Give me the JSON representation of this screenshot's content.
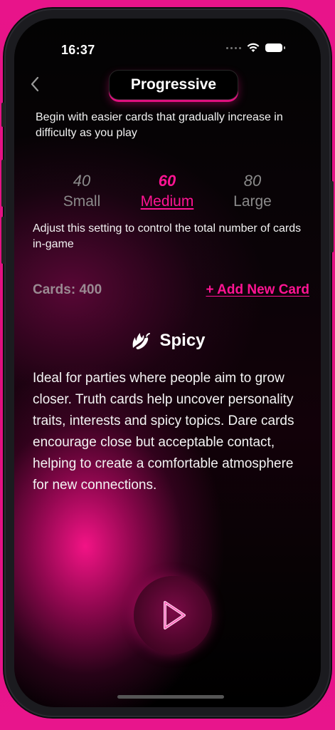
{
  "status_bar": {
    "time": "16:37"
  },
  "header": {
    "title": "Progressive"
  },
  "mode_description": "Begin with easier cards that gradually increase in difficulty as you play",
  "size_options": [
    {
      "count": "40",
      "label": "Small",
      "selected": false
    },
    {
      "count": "60",
      "label": "Medium",
      "selected": true
    },
    {
      "count": "80",
      "label": "Large",
      "selected": false
    }
  ],
  "size_description": "Adjust this setting to control the total number of cards in-game",
  "cards_count": "Cards: 400",
  "add_card_label": "+ Add New Card",
  "category": {
    "name": "Spicy",
    "icon": "chili-pepper-flame-icon",
    "description": "Ideal for parties where people aim to grow closer. Truth cards help uncover personality traits, interests and spicy topics. Dare cards encourage close but acceptable contact, helping to create a comfortable atmosphere for new connections."
  },
  "colors": {
    "accent": "#ff1493",
    "background": "#000000",
    "muted": "#8a8a8a"
  }
}
